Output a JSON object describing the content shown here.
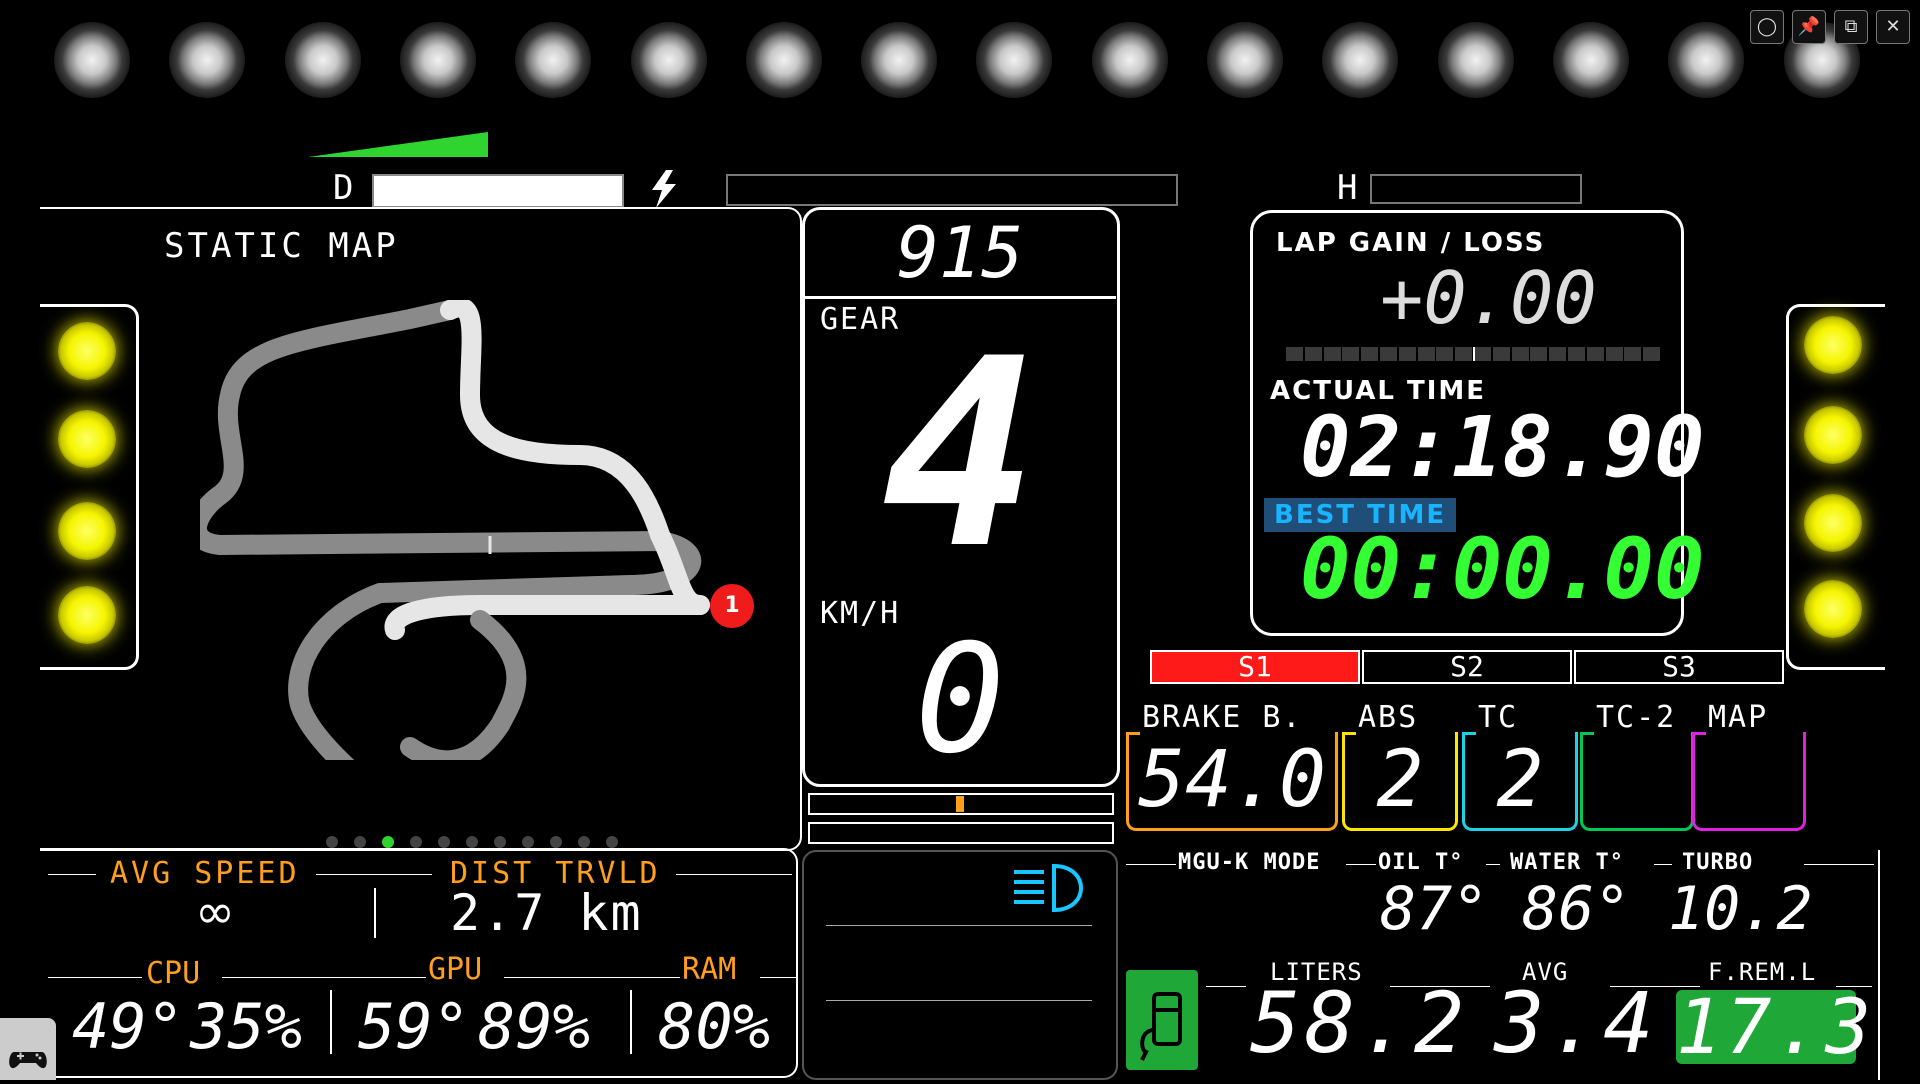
{
  "window": {
    "controls": [
      "◯",
      "📌",
      "⧉",
      "✕"
    ]
  },
  "top_bars": {
    "d_label": "D",
    "d_fill": 1.0,
    "h_label": "H"
  },
  "map": {
    "title": "STATIC MAP",
    "car_position": "1"
  },
  "center": {
    "rpm": "915",
    "gear_label": "GEAR",
    "gear": "4",
    "speed_label": "KM/H",
    "speed": "0"
  },
  "lap": {
    "gain_loss_label": "LAP GAIN / LOSS",
    "gain_loss_value": "+0.00",
    "actual_time_label": "ACTUAL TIME",
    "actual_time": "02:18.90",
    "best_time_label": "BEST TIME",
    "best_time": "00:00.00"
  },
  "sectors": [
    "S1",
    "S2",
    "S3"
  ],
  "settings": [
    {
      "label": "BRAKE B.",
      "value": "54.0",
      "color": "#ff9f1c"
    },
    {
      "label": "ABS",
      "value": "2",
      "color": "#ffe600"
    },
    {
      "label": "TC",
      "value": "2",
      "color": "#19d3e6"
    },
    {
      "label": "TC-2",
      "value": "",
      "color": "#00c853"
    },
    {
      "label": "MAP",
      "value": "",
      "color": "#e020e0"
    }
  ],
  "bottom_left": {
    "avg_speed_label": "AVG SPEED",
    "avg_speed": "∞",
    "dist_label": "DIST TRVLD",
    "dist": "2.7 km",
    "cpu_label": "CPU",
    "cpu_temp": "49°",
    "cpu_load": "35%",
    "gpu_label": "GPU",
    "gpu_temp": "59°",
    "gpu_load": "89%",
    "ram_label": "RAM",
    "ram": "80%"
  },
  "engine": {
    "mguk_label": "MGU-K MODE",
    "oil_label": "OIL T°",
    "oil": "87°",
    "water_label": "WATER T°",
    "water": "86°",
    "turbo_label": "TURBO",
    "turbo": "10.2"
  },
  "fuel": {
    "liters_label": "LITERS",
    "liters": "58.2",
    "avg_label": "AVG",
    "avg": "3.4",
    "frem_label": "F.REM.L",
    "frem": "17.3"
  },
  "colors": {
    "sector_active": "#ff1a1a",
    "best_time": "#33ff33",
    "best_badge": "#1f4e78",
    "fuel_green": "#1fa838",
    "headlight": "#19c6ff"
  }
}
